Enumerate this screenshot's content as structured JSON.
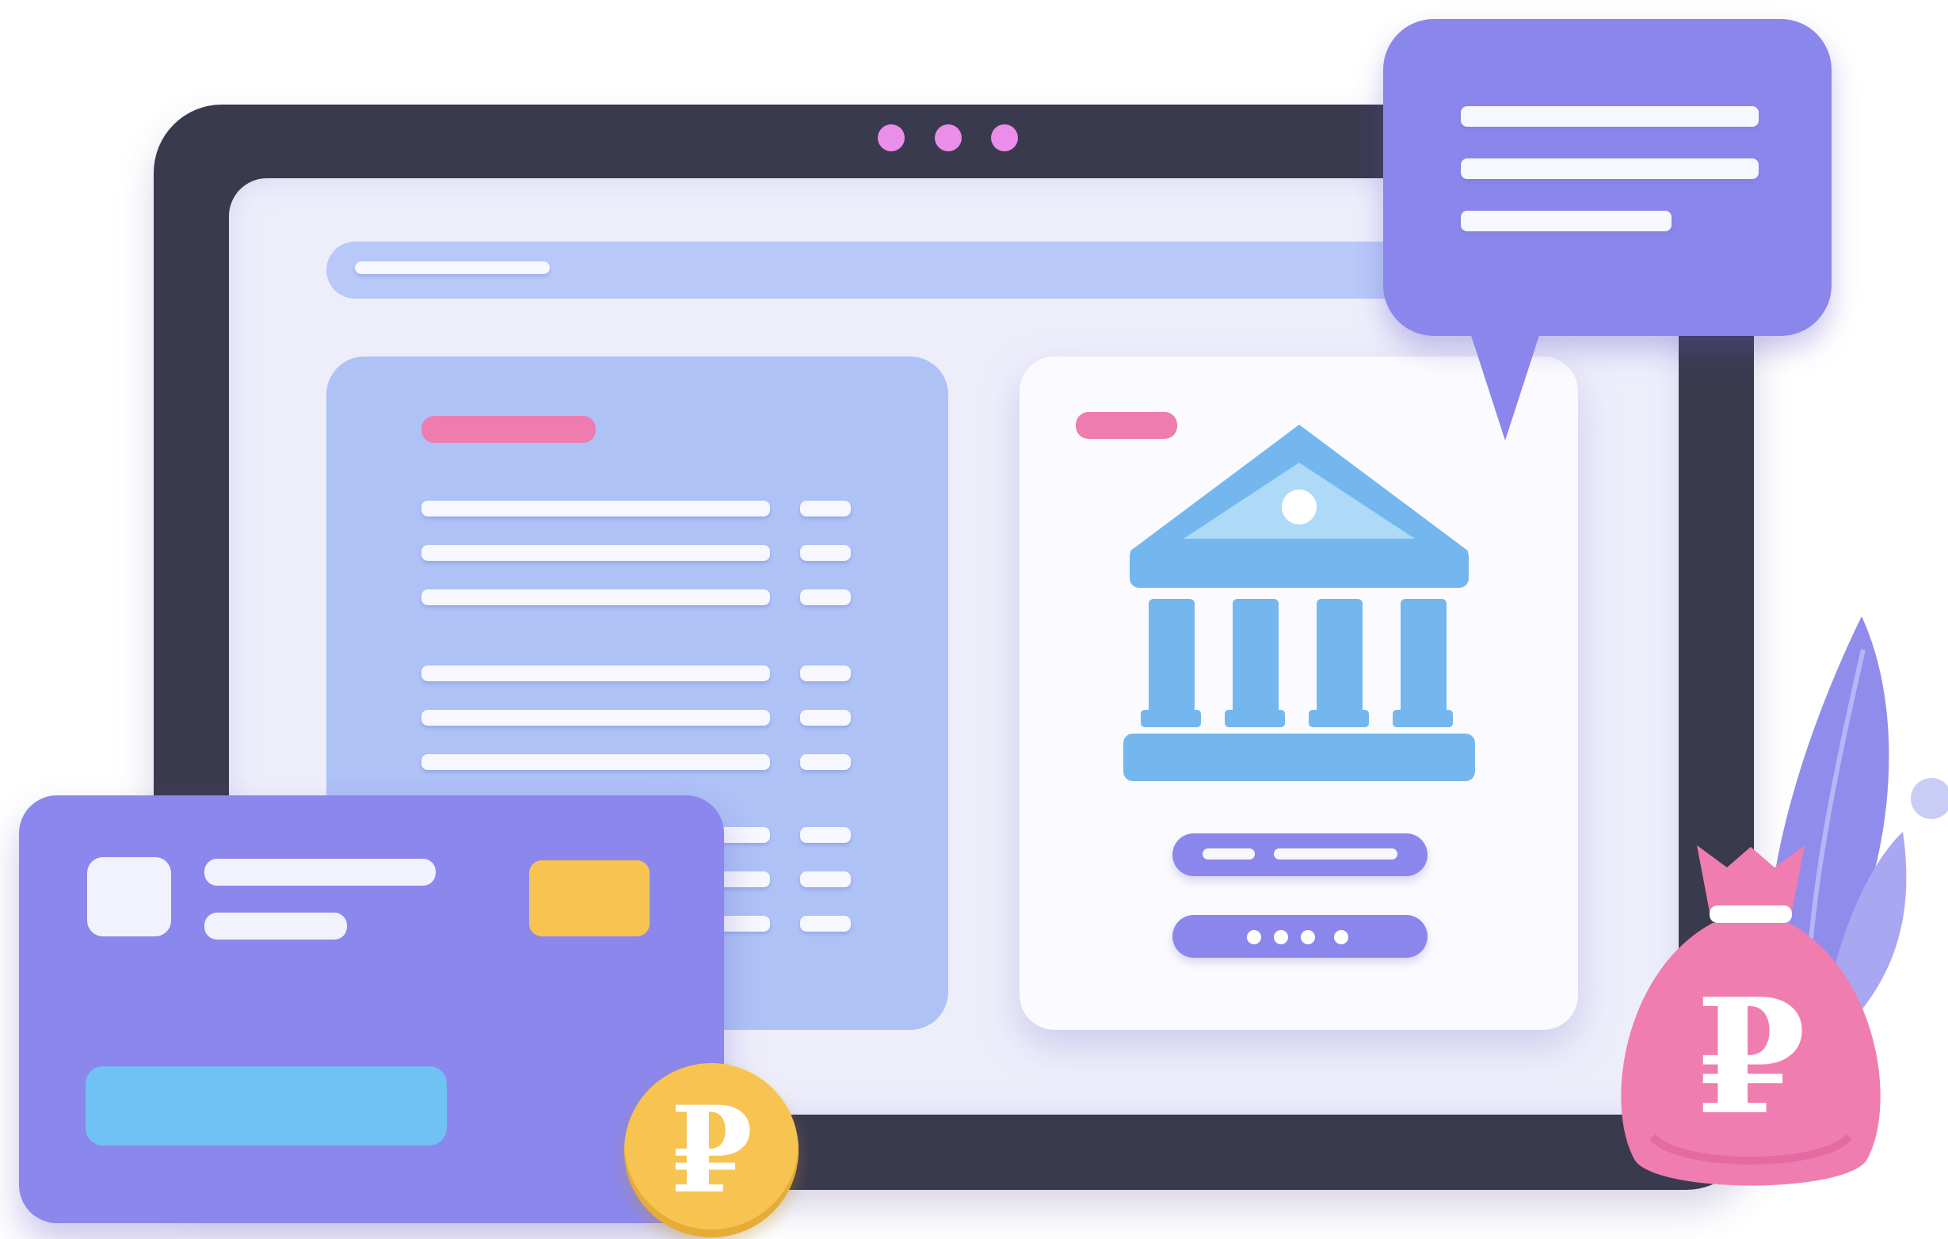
{
  "illustration": {
    "coin": {
      "symbol": "₽"
    },
    "money_bag": {
      "symbol": "₽"
    },
    "bank_icon": "bank-building",
    "pin_dots_count": 4,
    "colors": {
      "tablet_frame": "#3a3a4f",
      "screen_bg": "#eeeefb",
      "accent_purple": "#8b86ec",
      "panel_blue": "#aec2f6",
      "bank_blue": "#74b7ef",
      "pink_tag": "#ee7cae",
      "gold": "#f7c451",
      "bag_pink": "#f07db0"
    }
  }
}
